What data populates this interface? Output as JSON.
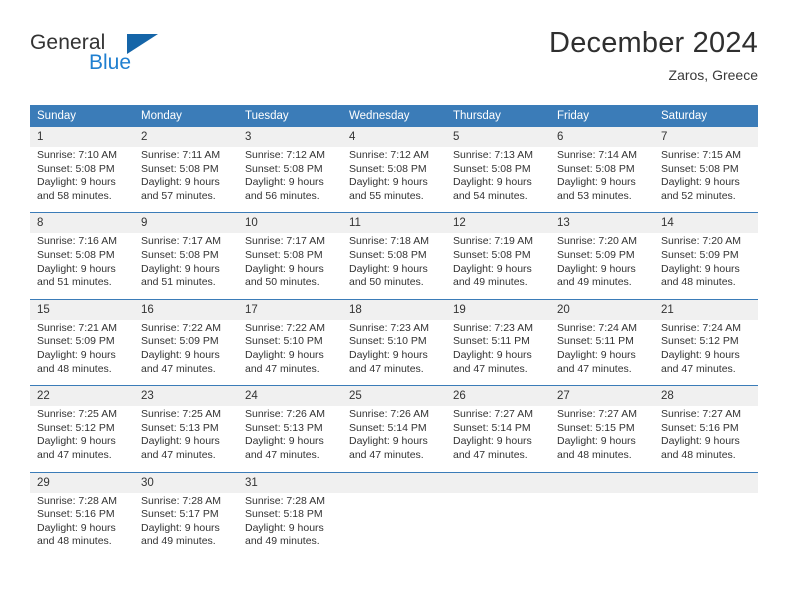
{
  "brand": {
    "name_part1": "General",
    "name_part2": "Blue",
    "triangle_color": "#1565a8",
    "blue_color": "#1f7fd0"
  },
  "header": {
    "title": "December 2024",
    "subtitle": "Zaros, Greece"
  },
  "theme": {
    "header_blue": "#3b7cb8",
    "date_band": "#f0f0f0",
    "text": "#333333"
  },
  "weekday_headers": [
    "Sunday",
    "Monday",
    "Tuesday",
    "Wednesday",
    "Thursday",
    "Friday",
    "Saturday"
  ],
  "weeks": [
    [
      {
        "date": "1",
        "sunrise": "Sunrise: 7:10 AM",
        "sunset": "Sunset: 5:08 PM",
        "daylight1": "Daylight: 9 hours",
        "daylight2": "and 58 minutes."
      },
      {
        "date": "2",
        "sunrise": "Sunrise: 7:11 AM",
        "sunset": "Sunset: 5:08 PM",
        "daylight1": "Daylight: 9 hours",
        "daylight2": "and 57 minutes."
      },
      {
        "date": "3",
        "sunrise": "Sunrise: 7:12 AM",
        "sunset": "Sunset: 5:08 PM",
        "daylight1": "Daylight: 9 hours",
        "daylight2": "and 56 minutes."
      },
      {
        "date": "4",
        "sunrise": "Sunrise: 7:12 AM",
        "sunset": "Sunset: 5:08 PM",
        "daylight1": "Daylight: 9 hours",
        "daylight2": "and 55 minutes."
      },
      {
        "date": "5",
        "sunrise": "Sunrise: 7:13 AM",
        "sunset": "Sunset: 5:08 PM",
        "daylight1": "Daylight: 9 hours",
        "daylight2": "and 54 minutes."
      },
      {
        "date": "6",
        "sunrise": "Sunrise: 7:14 AM",
        "sunset": "Sunset: 5:08 PM",
        "daylight1": "Daylight: 9 hours",
        "daylight2": "and 53 minutes."
      },
      {
        "date": "7",
        "sunrise": "Sunrise: 7:15 AM",
        "sunset": "Sunset: 5:08 PM",
        "daylight1": "Daylight: 9 hours",
        "daylight2": "and 52 minutes."
      }
    ],
    [
      {
        "date": "8",
        "sunrise": "Sunrise: 7:16 AM",
        "sunset": "Sunset: 5:08 PM",
        "daylight1": "Daylight: 9 hours",
        "daylight2": "and 51 minutes."
      },
      {
        "date": "9",
        "sunrise": "Sunrise: 7:17 AM",
        "sunset": "Sunset: 5:08 PM",
        "daylight1": "Daylight: 9 hours",
        "daylight2": "and 51 minutes."
      },
      {
        "date": "10",
        "sunrise": "Sunrise: 7:17 AM",
        "sunset": "Sunset: 5:08 PM",
        "daylight1": "Daylight: 9 hours",
        "daylight2": "and 50 minutes."
      },
      {
        "date": "11",
        "sunrise": "Sunrise: 7:18 AM",
        "sunset": "Sunset: 5:08 PM",
        "daylight1": "Daylight: 9 hours",
        "daylight2": "and 50 minutes."
      },
      {
        "date": "12",
        "sunrise": "Sunrise: 7:19 AM",
        "sunset": "Sunset: 5:08 PM",
        "daylight1": "Daylight: 9 hours",
        "daylight2": "and 49 minutes."
      },
      {
        "date": "13",
        "sunrise": "Sunrise: 7:20 AM",
        "sunset": "Sunset: 5:09 PM",
        "daylight1": "Daylight: 9 hours",
        "daylight2": "and 49 minutes."
      },
      {
        "date": "14",
        "sunrise": "Sunrise: 7:20 AM",
        "sunset": "Sunset: 5:09 PM",
        "daylight1": "Daylight: 9 hours",
        "daylight2": "and 48 minutes."
      }
    ],
    [
      {
        "date": "15",
        "sunrise": "Sunrise: 7:21 AM",
        "sunset": "Sunset: 5:09 PM",
        "daylight1": "Daylight: 9 hours",
        "daylight2": "and 48 minutes."
      },
      {
        "date": "16",
        "sunrise": "Sunrise: 7:22 AM",
        "sunset": "Sunset: 5:09 PM",
        "daylight1": "Daylight: 9 hours",
        "daylight2": "and 47 minutes."
      },
      {
        "date": "17",
        "sunrise": "Sunrise: 7:22 AM",
        "sunset": "Sunset: 5:10 PM",
        "daylight1": "Daylight: 9 hours",
        "daylight2": "and 47 minutes."
      },
      {
        "date": "18",
        "sunrise": "Sunrise: 7:23 AM",
        "sunset": "Sunset: 5:10 PM",
        "daylight1": "Daylight: 9 hours",
        "daylight2": "and 47 minutes."
      },
      {
        "date": "19",
        "sunrise": "Sunrise: 7:23 AM",
        "sunset": "Sunset: 5:11 PM",
        "daylight1": "Daylight: 9 hours",
        "daylight2": "and 47 minutes."
      },
      {
        "date": "20",
        "sunrise": "Sunrise: 7:24 AM",
        "sunset": "Sunset: 5:11 PM",
        "daylight1": "Daylight: 9 hours",
        "daylight2": "and 47 minutes."
      },
      {
        "date": "21",
        "sunrise": "Sunrise: 7:24 AM",
        "sunset": "Sunset: 5:12 PM",
        "daylight1": "Daylight: 9 hours",
        "daylight2": "and 47 minutes."
      }
    ],
    [
      {
        "date": "22",
        "sunrise": "Sunrise: 7:25 AM",
        "sunset": "Sunset: 5:12 PM",
        "daylight1": "Daylight: 9 hours",
        "daylight2": "and 47 minutes."
      },
      {
        "date": "23",
        "sunrise": "Sunrise: 7:25 AM",
        "sunset": "Sunset: 5:13 PM",
        "daylight1": "Daylight: 9 hours",
        "daylight2": "and 47 minutes."
      },
      {
        "date": "24",
        "sunrise": "Sunrise: 7:26 AM",
        "sunset": "Sunset: 5:13 PM",
        "daylight1": "Daylight: 9 hours",
        "daylight2": "and 47 minutes."
      },
      {
        "date": "25",
        "sunrise": "Sunrise: 7:26 AM",
        "sunset": "Sunset: 5:14 PM",
        "daylight1": "Daylight: 9 hours",
        "daylight2": "and 47 minutes."
      },
      {
        "date": "26",
        "sunrise": "Sunrise: 7:27 AM",
        "sunset": "Sunset: 5:14 PM",
        "daylight1": "Daylight: 9 hours",
        "daylight2": "and 47 minutes."
      },
      {
        "date": "27",
        "sunrise": "Sunrise: 7:27 AM",
        "sunset": "Sunset: 5:15 PM",
        "daylight1": "Daylight: 9 hours",
        "daylight2": "and 48 minutes."
      },
      {
        "date": "28",
        "sunrise": "Sunrise: 7:27 AM",
        "sunset": "Sunset: 5:16 PM",
        "daylight1": "Daylight: 9 hours",
        "daylight2": "and 48 minutes."
      }
    ],
    [
      {
        "date": "29",
        "sunrise": "Sunrise: 7:28 AM",
        "sunset": "Sunset: 5:16 PM",
        "daylight1": "Daylight: 9 hours",
        "daylight2": "and 48 minutes."
      },
      {
        "date": "30",
        "sunrise": "Sunrise: 7:28 AM",
        "sunset": "Sunset: 5:17 PM",
        "daylight1": "Daylight: 9 hours",
        "daylight2": "and 49 minutes."
      },
      {
        "date": "31",
        "sunrise": "Sunrise: 7:28 AM",
        "sunset": "Sunset: 5:18 PM",
        "daylight1": "Daylight: 9 hours",
        "daylight2": "and 49 minutes."
      },
      {
        "date": "",
        "sunrise": "",
        "sunset": "",
        "daylight1": "",
        "daylight2": ""
      },
      {
        "date": "",
        "sunrise": "",
        "sunset": "",
        "daylight1": "",
        "daylight2": ""
      },
      {
        "date": "",
        "sunrise": "",
        "sunset": "",
        "daylight1": "",
        "daylight2": ""
      },
      {
        "date": "",
        "sunrise": "",
        "sunset": "",
        "daylight1": "",
        "daylight2": ""
      }
    ]
  ]
}
